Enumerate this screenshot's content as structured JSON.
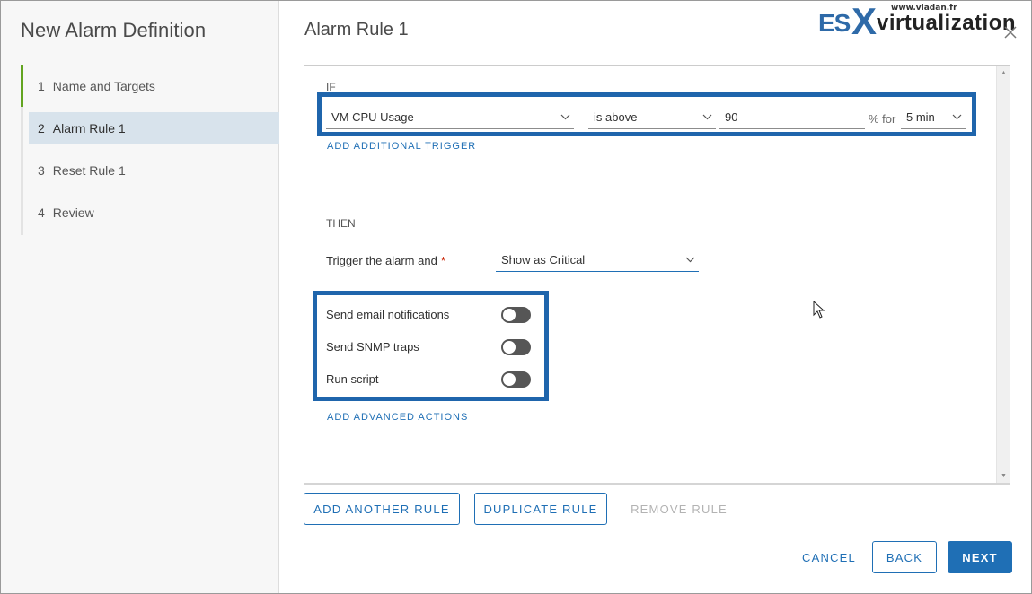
{
  "wizard": {
    "title": "New Alarm Definition",
    "steps": [
      {
        "num": "1",
        "label": "Name and Targets"
      },
      {
        "num": "2",
        "label": "Alarm Rule 1"
      },
      {
        "num": "3",
        "label": "Reset Rule 1"
      },
      {
        "num": "4",
        "label": "Review"
      }
    ]
  },
  "dialog": {
    "title": "Alarm Rule 1"
  },
  "logo": {
    "site": "www.vladan.fr",
    "es": "ES",
    "x": "X",
    "virt": "virtualization"
  },
  "rule": {
    "if_label": "IF",
    "condition": {
      "metric": "VM CPU Usage",
      "operator": "is above",
      "value": "90",
      "unit_label": "% for",
      "duration": "5 min"
    },
    "add_trigger_link": "ADD ADDITIONAL TRIGGER",
    "then_label": "THEN",
    "trigger_label": "Trigger the alarm and",
    "required_mark": "*",
    "severity": "Show as Critical",
    "actions": [
      {
        "label": "Send email notifications",
        "enabled": false
      },
      {
        "label": "Send SNMP traps",
        "enabled": false
      },
      {
        "label": "Run script",
        "enabled": false
      }
    ],
    "advanced_link": "ADD ADVANCED ACTIONS"
  },
  "rule_buttons": {
    "add": "ADD ANOTHER RULE",
    "duplicate": "DUPLICATE RULE",
    "remove": "REMOVE RULE"
  },
  "footer": {
    "cancel": "CANCEL",
    "back": "BACK",
    "next": "NEXT"
  },
  "colors": {
    "accent": "#1f6fb5",
    "highlight_border": "#1f65ac",
    "step_active_bar": "#62a420",
    "required": "#c92100"
  }
}
